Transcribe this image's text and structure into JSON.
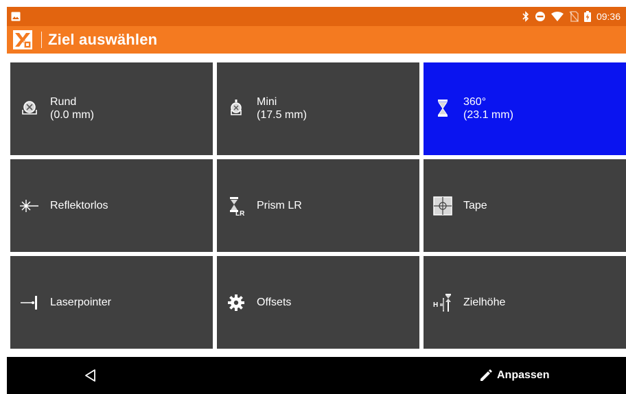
{
  "status_bar": {
    "time": "09:36",
    "icons": [
      "image-icon",
      "bluetooth-icon",
      "do-not-disturb-icon",
      "wifi-icon",
      "no-sim-icon",
      "battery-charging-icon"
    ]
  },
  "header": {
    "title": "Ziel auswählen",
    "logo_icon": "app-logo-icon"
  },
  "colors": {
    "status_bar": "#e2640f",
    "title_bar": "#f47a20",
    "tile": "#404040",
    "tile_selected": "#0a14f0",
    "bottom_bar": "#000000"
  },
  "tiles": [
    {
      "line1": "Rund",
      "line2": "(0.0 mm)",
      "icon": "round-prism-icon",
      "selected": false
    },
    {
      "line1": "Mini",
      "line2": "(17.5 mm)",
      "icon": "mini-prism-icon",
      "selected": false
    },
    {
      "line1": "360°",
      "line2": "(23.1 mm)",
      "icon": "prism-360-icon",
      "selected": true
    },
    {
      "line1": "Reflektorlos",
      "icon": "reflectorless-icon",
      "selected": false
    },
    {
      "line1": "Prism LR",
      "icon": "prism-lr-icon",
      "selected": false
    },
    {
      "line1": "Tape",
      "icon": "tape-target-icon",
      "selected": false
    },
    {
      "line1": "Laserpointer",
      "icon": "laserpointer-icon",
      "selected": false
    },
    {
      "line1": "Offsets",
      "icon": "gear-icon",
      "selected": false
    },
    {
      "line1": "Zielhöhe",
      "icon": "target-height-icon",
      "selected": false
    }
  ],
  "bottom_bar": {
    "back_icon": "back-triangle-icon",
    "customize_label": "Anpassen",
    "customize_icon": "pencil-icon"
  }
}
